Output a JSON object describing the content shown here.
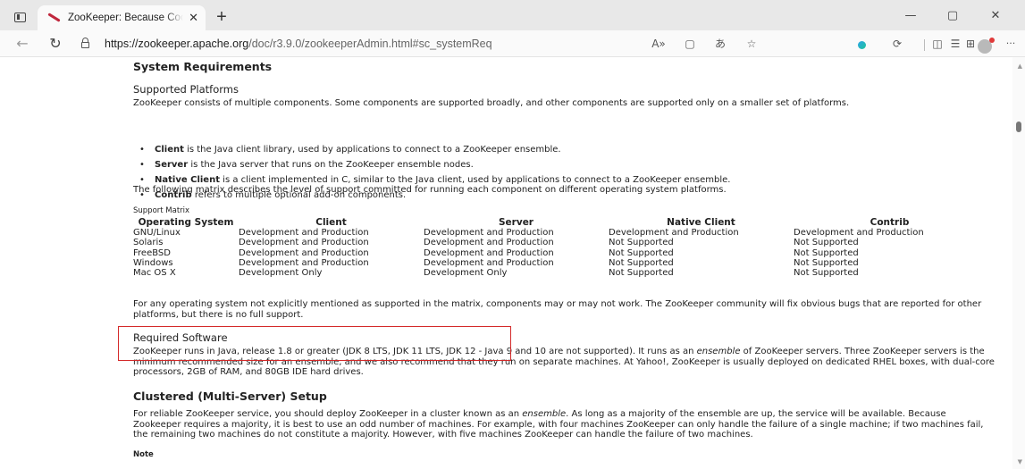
{
  "browser": {
    "tab_title": "ZooKeeper: Because Coordinating Distributed Systems is a Zoo",
    "tab_close": "✕",
    "new_tab": "+",
    "minimize": "—",
    "maximize": "▢",
    "close": "✕",
    "url_host": "https://zookeeper.apache.org",
    "url_path": "/doc/r3.9.0/zookeeperAdmin.html#sc_systemReq",
    "back": "←",
    "reload": "↻",
    "more": "···"
  },
  "page": {
    "sysreq_title": "System Requirements",
    "platforms_title": "Supported Platforms",
    "platforms_intro": "ZooKeeper consists of multiple components. Some components are supported broadly, and other components are supported only on a smaller set of platforms.",
    "bullets": [
      {
        "term": "Client",
        "text": " is the Java client library, used by applications to connect to a ZooKeeper ensemble."
      },
      {
        "term": "Server",
        "text": " is the Java server that runs on the ZooKeeper ensemble nodes."
      },
      {
        "term": "Native Client",
        "text": " is a client implemented in C, similar to the Java client, used by applications to connect to a ZooKeeper ensemble."
      },
      {
        "term": "Contrib",
        "text": " refers to multiple optional add-on components."
      }
    ],
    "matrix_intro": "The following matrix describes the level of support committed for running each component on different operating system platforms.",
    "matrix_caption": "Support Matrix",
    "matrix_headers": [
      "Operating System",
      "Client",
      "Server",
      "Native Client",
      "Contrib"
    ],
    "matrix_rows": [
      [
        "GNU/Linux",
        "Development and Production",
        "Development and Production",
        "Development and Production",
        "Development and Production"
      ],
      [
        "Solaris",
        "Development and Production",
        "Development and Production",
        "Not Supported",
        "Not Supported"
      ],
      [
        "FreeBSD",
        "Development and Production",
        "Development and Production",
        "Not Supported",
        "Not Supported"
      ],
      [
        "Windows",
        "Development and Production",
        "Development and Production",
        "Not Supported",
        "Not Supported"
      ],
      [
        "Mac OS X",
        "Development Only",
        "Development Only",
        "Not Supported",
        "Not Supported"
      ]
    ],
    "matrix_footer": "For any operating system not explicitly mentioned as supported in the matrix, components may or may not work. The ZooKeeper community will fix obvious bugs that are reported for other platforms, but there is no full support.",
    "reqsw_title": "Required Software",
    "reqsw_text_a": "ZooKeeper runs in Java, release 1.8 or greater (JDK 8 LTS, JDK 11 LTS, JDK 12 - Java 9 and 10 are not supported). It runs as an ",
    "reqsw_em": "ensemble",
    "reqsw_text_b": " of ZooKeeper servers. Three ZooKeeper servers is the minimum recommended size for an ensemble, and we also recommend that they run on separate machines. At Yahoo!, ZooKeeper is usually deployed on dedicated RHEL boxes, with dual-core processors, 2GB of RAM, and 80GB IDE hard drives.",
    "cluster_title": "Clustered (Multi-Server) Setup",
    "cluster_text_a": "For reliable ZooKeeper service, you should deploy ZooKeeper in a cluster known as an ",
    "cluster_em": "ensemble",
    "cluster_text_b": ". As long as a majority of the ensemble are up, the service will be available. Because Zookeeper requires a majority, it is best to use an odd number of machines. For example, with four machines ZooKeeper can only handle the failure of a single machine; if two machines fail, the remaining two machines do not constitute a majority. However, with five machines ZooKeeper can handle the failure of two machines.",
    "note_label": "Note"
  },
  "colors": {
    "highlight": "#d42a2a",
    "favicon": "#c0273d"
  }
}
